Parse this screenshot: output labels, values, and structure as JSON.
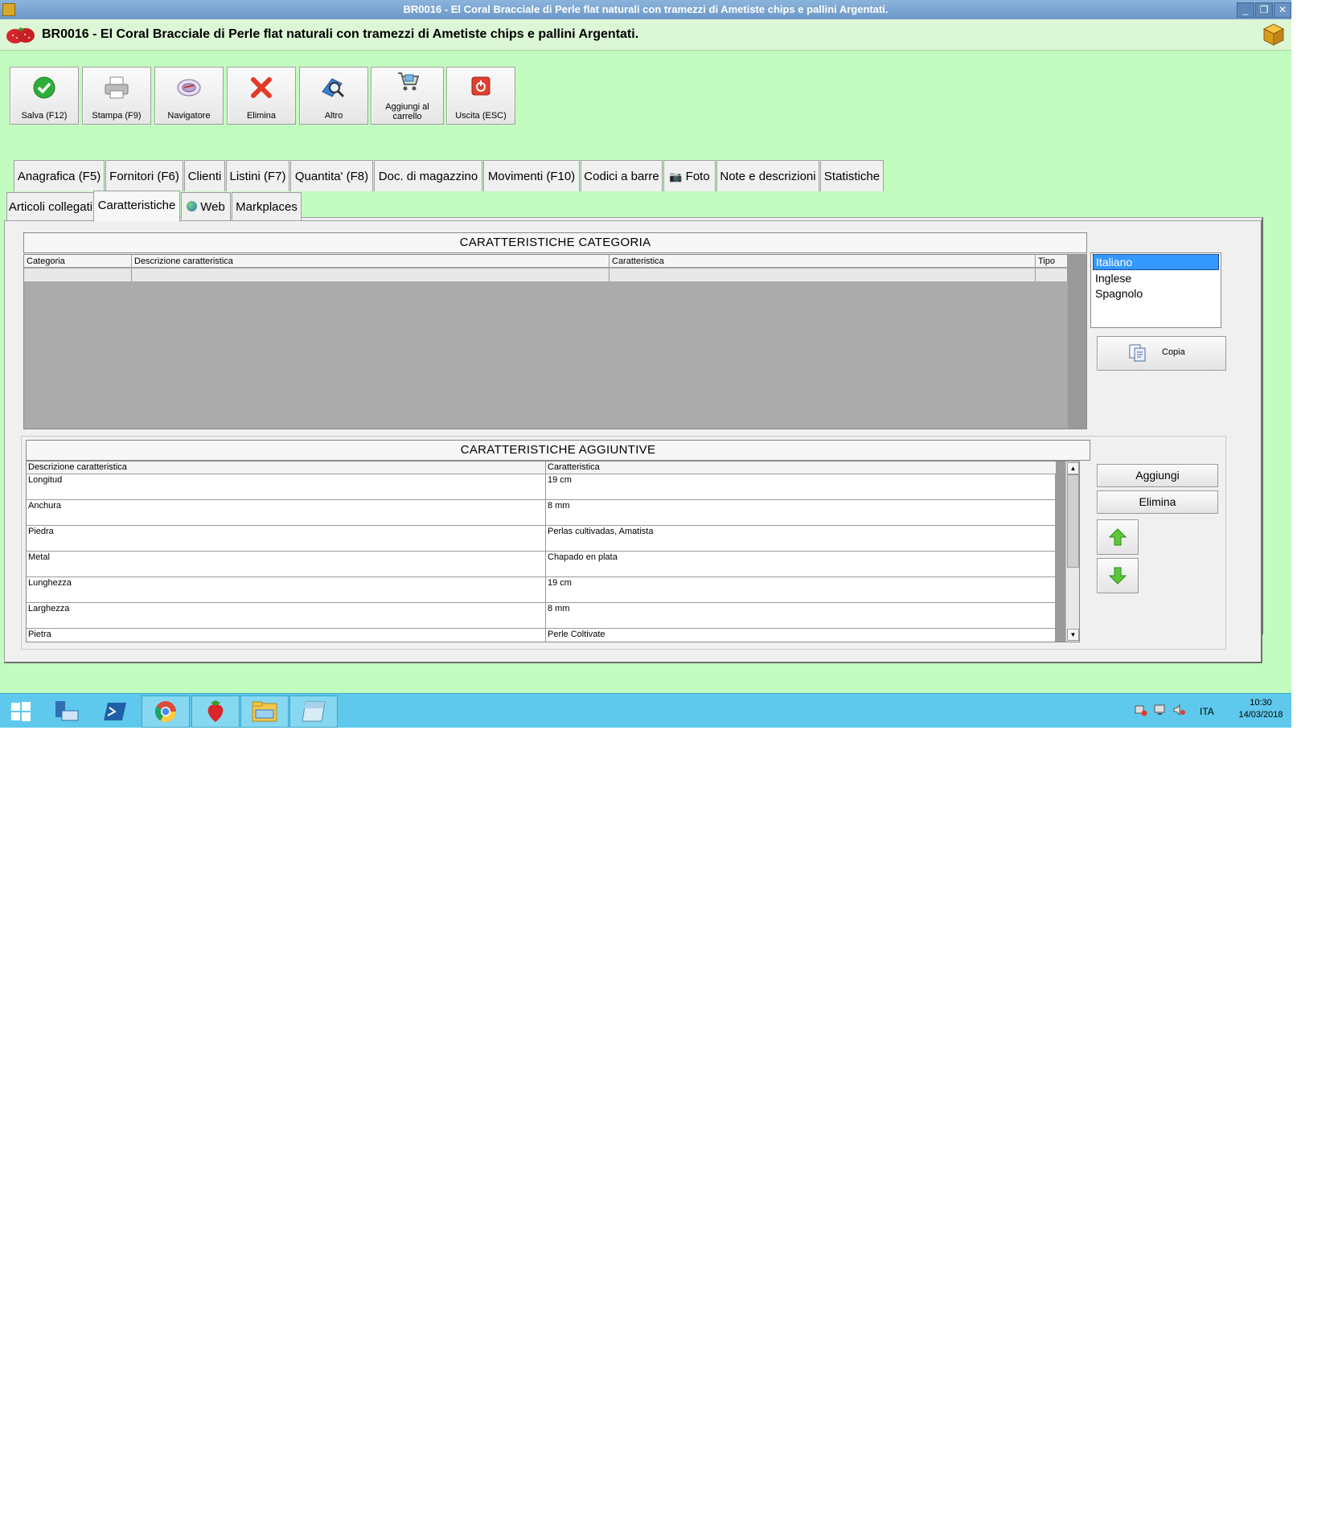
{
  "window": {
    "title": "BR0016 - El Coral Bracciale di Perle flat naturali con tramezzi di Ametiste chips e pallini Argentati.",
    "controls": {
      "minimize": "_",
      "restore": "❐",
      "close": "✕"
    }
  },
  "header": {
    "title": "BR0016 - El Coral Bracciale di Perle flat naturali con tramezzi di Ametiste chips e pallini Argentati."
  },
  "toolbar": [
    {
      "label": "Salva (F12)",
      "icon": "check-icon"
    },
    {
      "label": "Stampa (F9)",
      "icon": "printer-icon"
    },
    {
      "label": "Navigatore",
      "icon": "navigator-icon"
    },
    {
      "label": "Elimina",
      "icon": "delete-x-icon"
    },
    {
      "label": "Altro",
      "icon": "magnifier-icon"
    },
    {
      "label": "Aggiungi al carrello",
      "icon": "cart-icon"
    },
    {
      "label": "Uscita (ESC)",
      "icon": "exit-icon"
    }
  ],
  "tabs_row1": [
    "Anagrafica (F5)",
    "Fornitori (F6)",
    "Clienti",
    "Listini (F7)",
    "Quantita' (F8)",
    "Doc. di magazzino",
    "Movimenti (F10)",
    "Codici a barre",
    "Foto",
    "Note e descrizioni",
    "Statistiche"
  ],
  "tabs_row2": [
    "Articoli collegati",
    "Caratteristiche",
    "Web",
    "Markplaces"
  ],
  "active_tab": "Caratteristiche",
  "categoria_section": {
    "title": "CARATTERISTICHE CATEGORIA",
    "columns": [
      "Categoria",
      "Descrizione caratteristica",
      "Caratteristica",
      "Tipo"
    ]
  },
  "languages": {
    "items": [
      "Italiano",
      "Inglese",
      "Spagnolo"
    ],
    "selected": "Italiano"
  },
  "copy_button": "Copia",
  "aggiuntive_section": {
    "title": "CARATTERISTICHE AGGIUNTIVE",
    "columns": [
      "Descrizione caratteristica",
      "Caratteristica"
    ],
    "rows": [
      [
        "Longitud",
        "19 cm"
      ],
      [
        "Anchura",
        "8 mm"
      ],
      [
        "Piedra",
        "Perlas cultivadas, Amatista"
      ],
      [
        "Metal",
        "Chapado en plata"
      ],
      [
        "Lunghezza",
        "19 cm"
      ],
      [
        "Larghezza",
        "8 mm"
      ],
      [
        "Pietra",
        "Perle Coltivate"
      ]
    ]
  },
  "side_buttons": {
    "add": "Aggiungi",
    "delete": "Elimina"
  },
  "taskbar": {
    "language": "ITA",
    "time": "10:30",
    "date": "14/03/2018"
  },
  "colors": {
    "background": "#c3fcc0",
    "taskbar": "#5ec9ec",
    "selection": "#3399ff"
  }
}
